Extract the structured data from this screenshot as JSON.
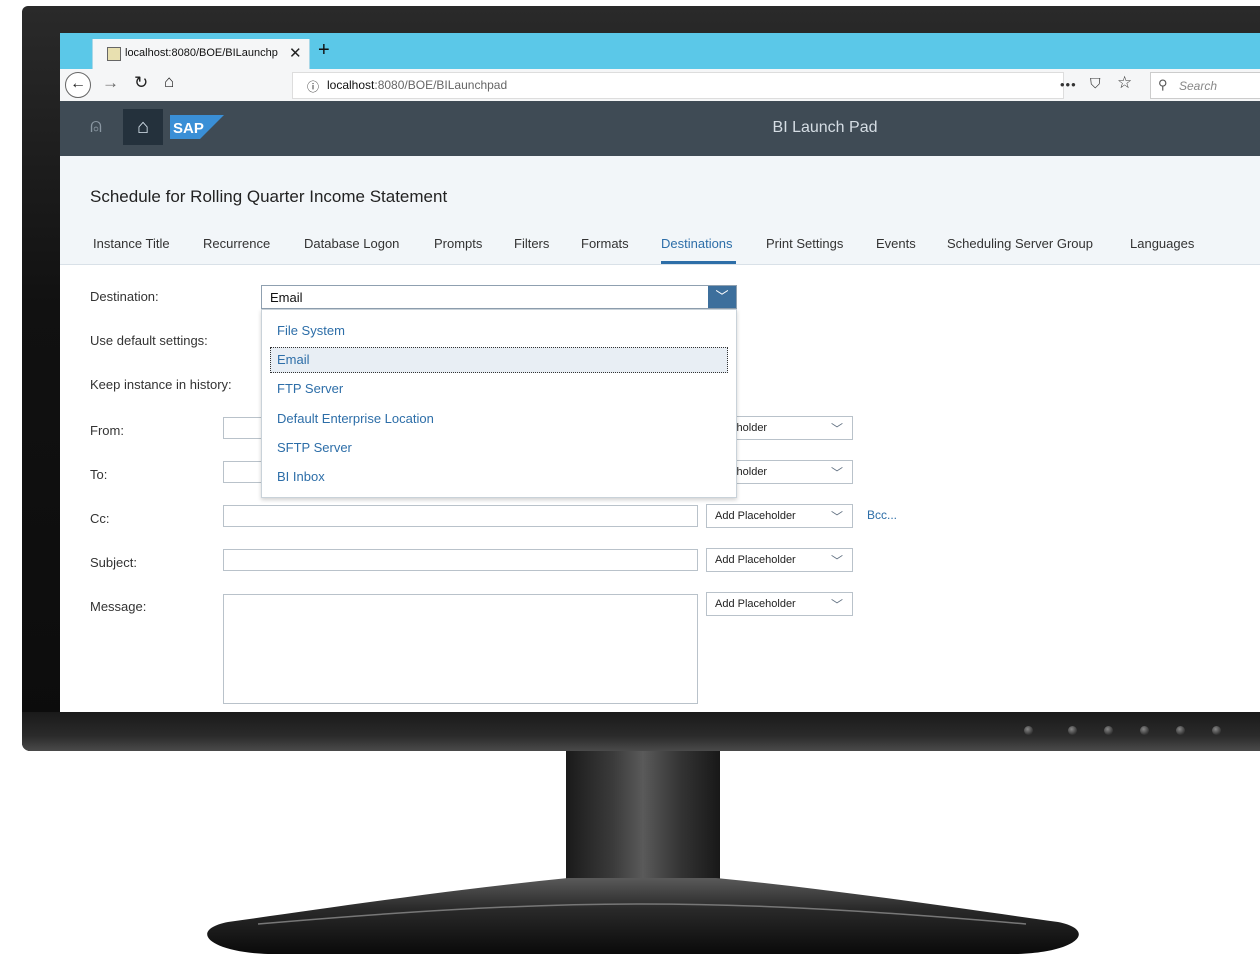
{
  "browser": {
    "tab_title": "localhost:8080/BOE/BILaunchp",
    "new_tab": "+",
    "close_tab": "✕",
    "url_host": "localhost",
    "url_path": ":8080/BOE/BILaunchpad",
    "search_placeholder": "Search",
    "icons": [
      "back-icon",
      "forward-icon",
      "reload-icon",
      "home-icon",
      "info-icon",
      "more-icon",
      "pocket-icon",
      "bookmark-star-icon",
      "search-icon"
    ]
  },
  "app": {
    "logo_text": "SAP",
    "title": "BI Launch Pad",
    "brand_color": "#3f4b55"
  },
  "dialog": {
    "title": "Schedule for Rolling Quarter Income Statement",
    "tabs": [
      {
        "label": "Instance Title"
      },
      {
        "label": "Recurrence"
      },
      {
        "label": "Database Logon"
      },
      {
        "label": "Prompts"
      },
      {
        "label": "Filters"
      },
      {
        "label": "Formats"
      },
      {
        "label": "Destinations"
      },
      {
        "label": "Print Settings"
      },
      {
        "label": "Events"
      },
      {
        "label": "Scheduling Server Group"
      },
      {
        "label": "Languages"
      }
    ],
    "active_tab": "Destinations"
  },
  "form": {
    "destination_label": "Destination:",
    "destination_value": "Email",
    "destination_options": [
      {
        "label": "File System"
      },
      {
        "label": "Email"
      },
      {
        "label": "FTP Server"
      },
      {
        "label": "Default Enterprise Location"
      },
      {
        "label": "SFTP Server"
      },
      {
        "label": "BI Inbox"
      }
    ],
    "use_default_label": "Use default settings:",
    "keep_instance_label": "Keep instance in history:",
    "from_label": "From:",
    "to_label": "To:",
    "cc_label": "Cc:",
    "subject_label": "Subject:",
    "message_label": "Message:",
    "placeholder_from": "Placeholder",
    "placeholder_to": "Placeholder",
    "placeholder_cc": "Add Placeholder",
    "placeholder_subject": "Add Placeholder",
    "placeholder_message": "Add Placeholder",
    "bcc_link": "Bcc..."
  }
}
